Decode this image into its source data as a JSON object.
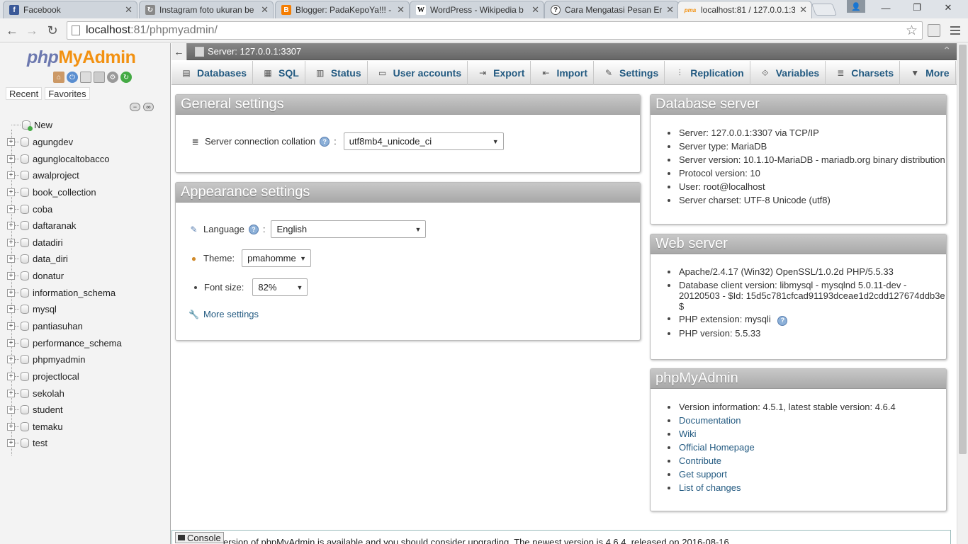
{
  "browser": {
    "tabs": [
      {
        "title": "Facebook",
        "favicon": "f",
        "color": "#3b5998"
      },
      {
        "title": "Instagram foto ukuran be",
        "favicon": "↻",
        "color": "#888888"
      },
      {
        "title": "Blogger: PadaKepoYa!!! -",
        "favicon": "B",
        "color": "#f57d00"
      },
      {
        "title": "WordPress - Wikipedia b",
        "favicon": "W",
        "color": "#ffffff"
      },
      {
        "title": "Cara Mengatasi Pesan Er",
        "favicon": "?",
        "color": "#ffffff"
      },
      {
        "title": "localhost:81 / 127.0.0.1:3",
        "favicon": "pma",
        "color": "#f29111"
      }
    ],
    "url_host": "localhost",
    "url_rest": ":81/phpmyadmin/"
  },
  "nav": {
    "logo_php": "php",
    "logo_my": "My",
    "logo_admin": "Admin",
    "recent": "Recent",
    "favorites": "Favorites",
    "new_label": "New",
    "databases": [
      "agungdev",
      "agunglocaltobacco",
      "awalproject",
      "book_collection",
      "coba",
      "daftaranak",
      "datadiri",
      "data_diri",
      "donatur",
      "information_schema",
      "mysql",
      "pantiasuhan",
      "performance_schema",
      "phpmyadmin",
      "projectlocal",
      "sekolah",
      "student",
      "temaku",
      "test"
    ]
  },
  "serverbar": {
    "back": "←",
    "label": "Server: 127.0.0.1:3307"
  },
  "topmenu": [
    {
      "label": "Databases",
      "icon": "database-icon"
    },
    {
      "label": "SQL",
      "icon": "sql-icon"
    },
    {
      "label": "Status",
      "icon": "status-icon"
    },
    {
      "label": "User accounts",
      "icon": "users-icon"
    },
    {
      "label": "Export",
      "icon": "export-icon"
    },
    {
      "label": "Import",
      "icon": "import-icon"
    },
    {
      "label": "Settings",
      "icon": "wrench-icon"
    },
    {
      "label": "Replication",
      "icon": "replication-icon"
    },
    {
      "label": "Variables",
      "icon": "variables-icon"
    },
    {
      "label": "Charsets",
      "icon": "charsets-icon"
    },
    {
      "label": "More",
      "icon": "chevron-down-icon"
    }
  ],
  "general": {
    "title": "General settings",
    "collation_label": "Server connection collation",
    "collation_colon": ":",
    "collation_value": "utf8mb4_unicode_ci"
  },
  "appearance": {
    "title": "Appearance settings",
    "language_label": "Language",
    "language_colon": ":",
    "language_value": "English",
    "theme_label": "Theme:",
    "theme_value": "pmahomme",
    "fontsize_label": "Font size:",
    "fontsize_value": "82%",
    "more_settings": "More settings"
  },
  "dbserver": {
    "title": "Database server",
    "items": [
      "Server: 127.0.0.1:3307 via TCP/IP",
      "Server type: MariaDB",
      "Server version: 10.1.10-MariaDB - mariadb.org binary distribution",
      "Protocol version: 10",
      "User: root@localhost",
      "Server charset: UTF-8 Unicode (utf8)"
    ]
  },
  "webserver": {
    "title": "Web server",
    "apache": "Apache/2.4.17 (Win32) OpenSSL/1.0.2d PHP/5.5.33",
    "client_1": "Database client version: libmysql - mysqlnd 5.0.11-dev -",
    "client_2": "20120503 - $Id: 15d5c781cfcad91193dceae1d2cdd127674ddb3e",
    "client_3": "$",
    "php_ext": "PHP extension: mysqli",
    "php_version": "PHP version: 5.5.33"
  },
  "pma": {
    "title": "phpMyAdmin",
    "version_info": "Version information: 4.5.1, latest stable version: 4.6.4",
    "links": [
      "Documentation",
      "Wiki",
      "Official Homepage",
      "Contribute",
      "Get support",
      "List of changes"
    ]
  },
  "console": {
    "label": "Console",
    "message": "ersion of phpMyAdmin is available and you should consider upgrading. The newest version is 4.6.4, released on 2016-08-16."
  },
  "colors": {
    "link": "#235a81",
    "logo_orange": "#f29111",
    "logo_blue": "#6c78af"
  }
}
